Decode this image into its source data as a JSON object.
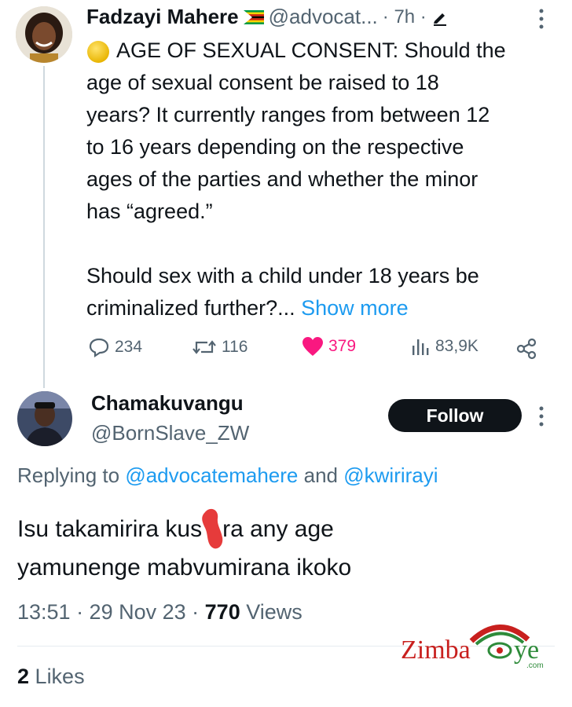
{
  "tweet": {
    "author_name": "Fadzayi Mahere",
    "handle": "@advocat...",
    "time": "· 7h ·",
    "body_lines": [
      "AGE OF SEXUAL CONSENT: Should the",
      "age of sexual consent be raised to 18",
      "years? It currently ranges from between 12",
      "to 16 years depending on the respective",
      "ages of the parties and whether the minor",
      "has “agreed.”"
    ],
    "body2_lines": [
      "Should sex with a child under 18 years be"
    ],
    "body2_last": "criminalized further?...",
    "show_more": "Show more",
    "replies": "234",
    "reposts": "116",
    "likes": "379",
    "views": "83,9K"
  },
  "reply": {
    "author_name": "Chamakuvangu",
    "handle": "@BornSlave_ZW",
    "follow_label": "Follow",
    "replying_prefix": "Replying to",
    "mention1": "@advocatemahere",
    "and": "and",
    "mention2": "@kwirirayi",
    "text_line1": "Isu takamirira kus",
    "text_line1_end": "ra any age",
    "text_line2": "yamunenge mabvumirana ikoko",
    "timestamp": "13:51 · 29 Nov 23 ·",
    "view_count": "770",
    "views_label": "Views",
    "like_count": "2",
    "likes_label": "Likes"
  },
  "watermark": {
    "brand": "ZimbaEye",
    "tld": ".com"
  },
  "colors": {
    "accent": "#1d9bf0",
    "like": "#f91880",
    "text": "#0f1419",
    "muted": "#536471"
  }
}
